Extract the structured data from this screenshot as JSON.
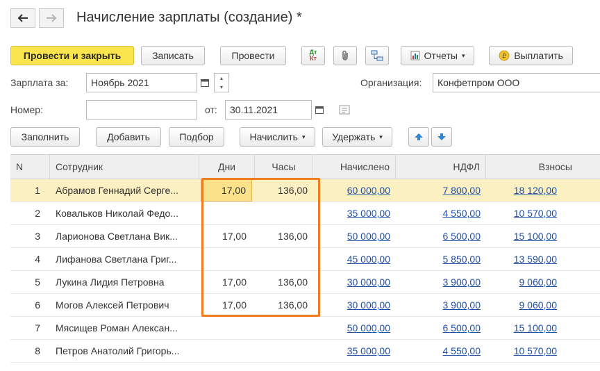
{
  "window": {
    "title": "Начисление зарплаты (создание) *",
    "back_icon": "arrow-left-icon",
    "forward_icon": "arrow-right-icon"
  },
  "toolbar": {
    "post_close": "Провести и закрыть",
    "save": "Записать",
    "post": "Провести",
    "dtkt_top": "Дт",
    "dtkt_bottom": "Кт",
    "reports": "Отчеты",
    "pay": "Выплатить"
  },
  "form": {
    "salary_for_label": "Зарплата за:",
    "salary_for_value": "Ноябрь 2021",
    "org_label": "Организация:",
    "org_value": "Конфетпром ООО",
    "number_label": "Номер:",
    "number_value": "",
    "date_label": "от:",
    "date_value": "30.11.2021"
  },
  "table_toolbar": {
    "fill": "Заполнить",
    "add": "Добавить",
    "pick": "Подбор",
    "accrue": "Начислить",
    "withhold": "Удержать"
  },
  "table": {
    "columns": [
      "N",
      "Сотрудник",
      "Дни",
      "Часы",
      "Начислено",
      "НДФЛ",
      "Взносы"
    ],
    "rows": [
      {
        "n": "1",
        "employee": "Абрамов Геннадий Серге...",
        "days": "17,00",
        "hours": "136,00",
        "accrued": "60 000,00",
        "ndfl": "7 800,00",
        "contrib": "18 120,00"
      },
      {
        "n": "2",
        "employee": "Ковальков Николай Федо...",
        "days": "",
        "hours": "",
        "accrued": "35 000,00",
        "ndfl": "4 550,00",
        "contrib": "10 570,00"
      },
      {
        "n": "3",
        "employee": "Ларионова Светлана Вик...",
        "days": "17,00",
        "hours": "136,00",
        "accrued": "50 000,00",
        "ndfl": "6 500,00",
        "contrib": "15 100,00"
      },
      {
        "n": "4",
        "employee": "Лифанова Светлана Григ...",
        "days": "",
        "hours": "",
        "accrued": "45 000,00",
        "ndfl": "5 850,00",
        "contrib": "13 590,00"
      },
      {
        "n": "5",
        "employee": "Лукина Лидия Петровна",
        "days": "17,00",
        "hours": "136,00",
        "accrued": "30 000,00",
        "ndfl": "3 900,00",
        "contrib": "9 060,00"
      },
      {
        "n": "6",
        "employee": "Могов Алексей Петрович",
        "days": "17,00",
        "hours": "136,00",
        "accrued": "30 000,00",
        "ndfl": "3 900,00",
        "contrib": "9 060,00"
      },
      {
        "n": "7",
        "employee": "Мясищев Роман Алексан...",
        "days": "",
        "hours": "",
        "accrued": "50 000,00",
        "ndfl": "6 500,00",
        "contrib": "15 100,00"
      },
      {
        "n": "8",
        "employee": "Петров Анатолий Григорь...",
        "days": "",
        "hours": "",
        "accrued": "35 000,00",
        "ndfl": "4 550,00",
        "contrib": "10 570,00"
      }
    ]
  },
  "colors": {
    "primary_button": "#fbe54c",
    "link": "#1f4fa3",
    "selected_row": "#fbf0c2",
    "highlight_box": "#f07d1d"
  }
}
